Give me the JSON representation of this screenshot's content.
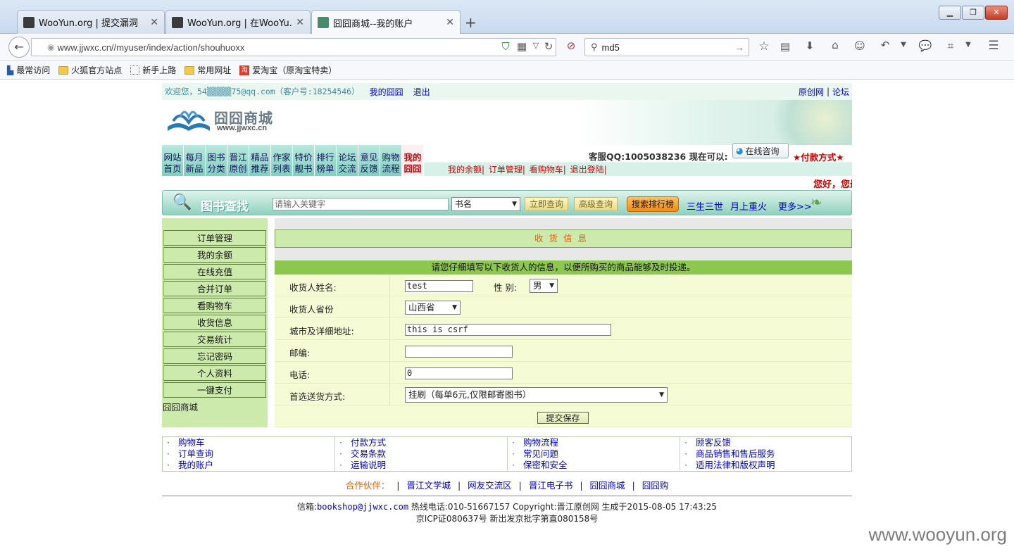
{
  "browser": {
    "tabs": [
      {
        "title": "WooYun.org | 提交漏洞"
      },
      {
        "title": "WooYun.org | 在WooYu..."
      },
      {
        "title": "囧囧商城--我的账户"
      }
    ],
    "new_tab": "+",
    "url": "www.jjwxc.cn//myuser/index/action/shouhuoxx",
    "search_value": "md5",
    "bookmarks": [
      "最常访问",
      "火狐官方站点",
      "新手上路",
      "常用网址",
      "爱淘宝（原淘宝特卖）"
    ]
  },
  "header": {
    "welcome": "欢迎您，54▒▒▒▒▒75@qq.com（客户号:18254546）",
    "my_shop": "我的囧囧",
    "logout": "退出",
    "site_original": "原创网",
    "forum": "论坛",
    "logo_text": "囧囧商城",
    "logo_url": "www.jjwxc.cn",
    "service_qq": "客服QQ:1005038236  现在可以:",
    "online_consult": "在线咨询",
    "payment": "★付款方式★",
    "greeting": "您好，您最"
  },
  "menu": [
    {
      "l1": "网站",
      "l2": "首页"
    },
    {
      "l1": "每月",
      "l2": "新品"
    },
    {
      "l1": "图书",
      "l2": "分类"
    },
    {
      "l1": "晋江",
      "l2": "原创"
    },
    {
      "l1": "精品",
      "l2": "推荐"
    },
    {
      "l1": "作家",
      "l2": "列表"
    },
    {
      "l1": "特价",
      "l2": "靓书"
    },
    {
      "l1": "排行",
      "l2": "榜单"
    },
    {
      "l1": "论坛",
      "l2": "交流"
    },
    {
      "l1": "意见",
      "l2": "反馈"
    },
    {
      "l1": "购物",
      "l2": "流程"
    },
    {
      "l1": "我的",
      "l2": "囧囧"
    }
  ],
  "sublinks": [
    "我的余额",
    "订单管理",
    "看购物车",
    "退出登陆"
  ],
  "search": {
    "title": "图书查找",
    "placeholder": "请输入关键字",
    "field": "书名",
    "query_btn": "立即查询",
    "advanced_btn": "高级查询",
    "rank_btn": "搜索排行榜",
    "links": [
      "三生三世",
      "月上重火",
      "更多>>"
    ]
  },
  "leftnav": {
    "items": [
      "订单管理",
      "我的余额",
      "在线充值",
      "合并订单",
      "看购物车",
      "收货信息",
      "交易统计",
      "忘记密码",
      "个人资料",
      "一键支付"
    ],
    "footer": "囧囧商城"
  },
  "form": {
    "title": "收货信息",
    "instruction": "请您仔细填写以下收货人的信息，以便所购买的商品能够及时投递。",
    "name_label": "收货人姓名:",
    "name_value": "test",
    "gender_label": "性 别:",
    "gender_value": "男",
    "province_label": "收货人省份",
    "province_value": "山西省",
    "address_label": "城市及详细地址:",
    "address_value": "this is csrf",
    "zip_label": "邮编:",
    "zip_value": "",
    "phone_label": "电话:",
    "phone_value": "0",
    "delivery_label": "首选送货方式:",
    "delivery_value": "挂刷（每单6元,仅限邮寄图书）",
    "submit": "提交保存"
  },
  "footer": {
    "col1": [
      "购物车",
      "订单查询",
      "我的账户"
    ],
    "col2": [
      "付款方式",
      "交易条款",
      "运输说明"
    ],
    "col3": [
      "购物流程",
      "常见问题",
      "保密和安全"
    ],
    "col4": [
      "顾客反馈",
      "商品销售和售后服务",
      "适用法律和版权声明"
    ],
    "partners_label": "合作伙伴：",
    "partners": [
      "晋江文学城",
      "网友交流区",
      "晋江电子书",
      "囧囧商城",
      "囧囧购"
    ],
    "copy1a": "信箱:",
    "email": "bookshop@jjwxc.com",
    "copy1b": " 热线电话:010-51667157 Copyright:晋江原创网 生成于2015-08-05 17:43:25",
    "copy2": "京ICP证080637号   新出发京批字第直080158号"
  },
  "watermark": "www.wooyun.org"
}
